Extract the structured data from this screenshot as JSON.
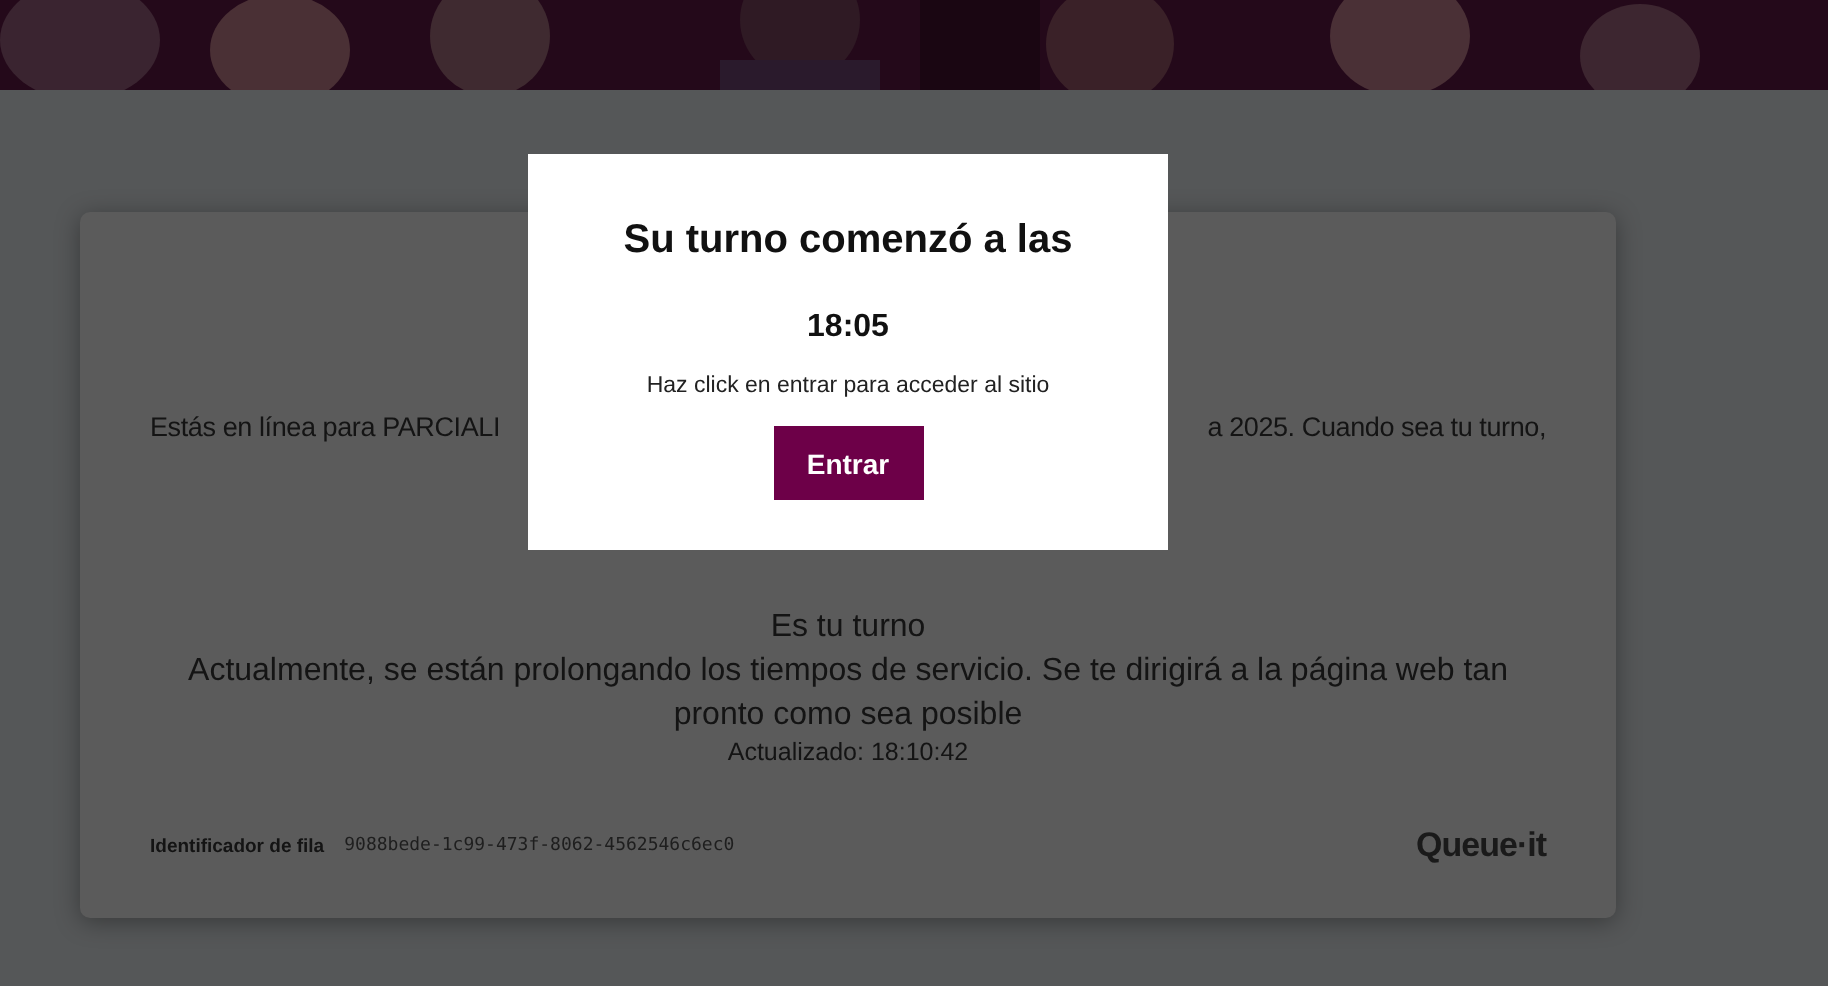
{
  "card": {
    "intro_left": "Estás en línea para PARCIALI",
    "intro_right": "a 2025. Cuando sea tu turno,",
    "status_title": "Es tu turno",
    "status_message": "Actualmente, se están prolongando los tiempos de servicio. Se te dirigirá a la página web tan pronto como sea posible",
    "updated": "Actualizado: 18:10:42",
    "queue_id_label": "Identificador de fila",
    "queue_id": "9088bede-1c99-473f-8062-4562546c6ec0",
    "logo": "Queue·it"
  },
  "modal": {
    "title": "Su turno comenzó a las",
    "time": "18:05",
    "message": "Haz click en entrar para acceder al sitio",
    "button": "Entrar"
  }
}
